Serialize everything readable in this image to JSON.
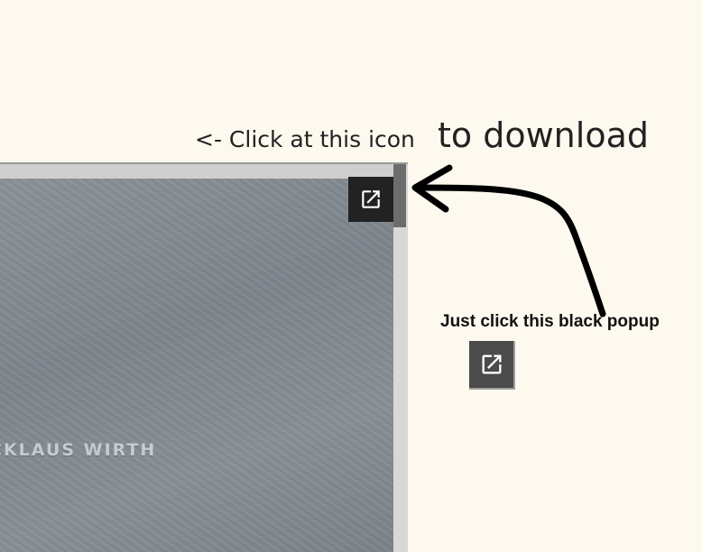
{
  "annotation": {
    "hint_prefix": "<- Click at this icon",
    "hint_suffix": "to download",
    "instruction": "Just click this black popup"
  },
  "viewer": {
    "cover_text": "CKLAUS WIRTH"
  },
  "icons": {
    "popout": "open-in-new-icon"
  }
}
